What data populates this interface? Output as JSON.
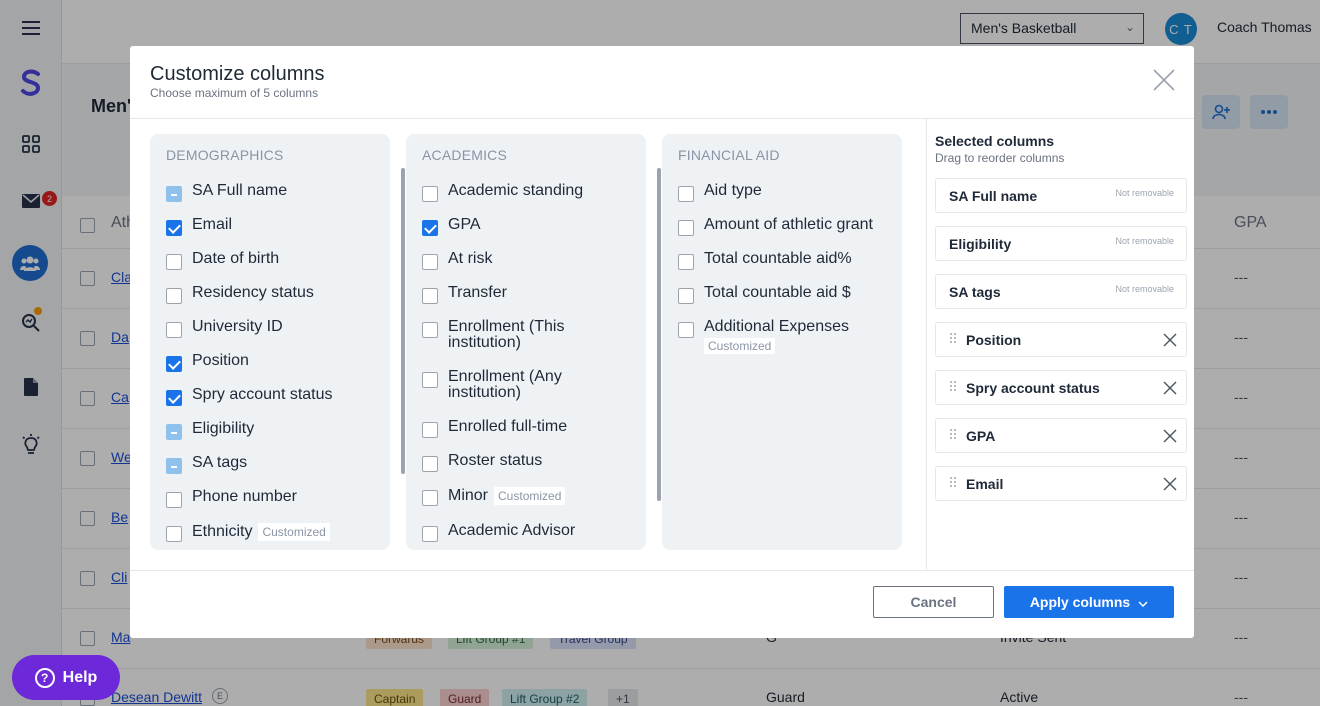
{
  "topbar": {
    "team": "Men's Basketball",
    "avatar_initials": "C T",
    "coach_name": "Coach Thomas"
  },
  "sidebar": {
    "mail_badge": "2"
  },
  "page": {
    "title": "Men'"
  },
  "table": {
    "header_partial": "Ath",
    "gpa_header": "GPA",
    "rows": [
      {
        "name": "Cla",
        "gpa": "---"
      },
      {
        "name": "Da",
        "gpa": "---"
      },
      {
        "name": "Ca",
        "gpa": "---"
      },
      {
        "name": "We",
        "gpa": "---"
      },
      {
        "name": "Be",
        "gpa": "---"
      },
      {
        "name": "Cli",
        "gpa": "---"
      },
      {
        "name": "Ma",
        "gpa": "---",
        "tags": [
          "Forwards",
          "Lift Group #1",
          "Travel Group"
        ],
        "position": "G",
        "status": "Invite Sent"
      },
      {
        "name": "Desean Dewitt",
        "gpa": "---",
        "tags": [
          "Captain",
          "Guard",
          "Lift Group #2",
          "+1"
        ],
        "position": "Guard",
        "status": "Active",
        "name_badge": "E"
      }
    ]
  },
  "help": {
    "label": "Help"
  },
  "modal": {
    "title": "Customize columns",
    "subtitle": "Choose maximum of 5 columns",
    "customized_label": "Customized",
    "demographics": {
      "heading": "DEMOGRAPHICS",
      "items": [
        {
          "label": "SA Full name",
          "state": "partial"
        },
        {
          "label": "Email",
          "state": "checked"
        },
        {
          "label": "Date of birth",
          "state": "unchecked"
        },
        {
          "label": "Residency status",
          "state": "unchecked"
        },
        {
          "label": "University ID",
          "state": "unchecked"
        },
        {
          "label": "Position",
          "state": "checked"
        },
        {
          "label": "Spry account status",
          "state": "checked"
        },
        {
          "label": "Eligibility",
          "state": "partial"
        },
        {
          "label": "SA tags",
          "state": "partial"
        },
        {
          "label": "Phone number",
          "state": "unchecked"
        },
        {
          "label": "Ethnicity",
          "state": "unchecked",
          "customized": true
        }
      ]
    },
    "academics": {
      "heading": "ACADEMICS",
      "items": [
        {
          "label": "Academic standing",
          "state": "unchecked"
        },
        {
          "label": "GPA",
          "state": "checked"
        },
        {
          "label": "At risk",
          "state": "unchecked"
        },
        {
          "label": "Transfer",
          "state": "unchecked"
        },
        {
          "label": "Enrollment (This institution)",
          "state": "unchecked"
        },
        {
          "label": "Enrollment (Any institution)",
          "state": "unchecked"
        },
        {
          "label": "Enrolled full-time",
          "state": "unchecked"
        },
        {
          "label": "Roster status",
          "state": "unchecked"
        },
        {
          "label": "Minor",
          "state": "unchecked",
          "customized": true
        },
        {
          "label": "Academic Advisor",
          "state": "unchecked"
        }
      ]
    },
    "financial_aid": {
      "heading": "FINANCIAL AID",
      "items": [
        {
          "label": "Aid type",
          "state": "unchecked"
        },
        {
          "label": "Amount of athletic grant",
          "state": "unchecked"
        },
        {
          "label": "Total countable aid%",
          "state": "unchecked"
        },
        {
          "label": "Total countable aid $",
          "state": "unchecked"
        },
        {
          "label": "Additional Expenses",
          "state": "unchecked",
          "customized": true
        }
      ]
    },
    "selected": {
      "title": "Selected columns",
      "subtitle": "Drag to reorder columns",
      "not_removable_label": "Not removable",
      "items": [
        {
          "label": "SA Full name",
          "removable": false
        },
        {
          "label": "Eligibility",
          "removable": false
        },
        {
          "label": "SA tags",
          "removable": false
        },
        {
          "label": "Position",
          "removable": true
        },
        {
          "label": "Spry account status",
          "removable": true
        },
        {
          "label": "GPA",
          "removable": true
        },
        {
          "label": "Email",
          "removable": true
        }
      ]
    },
    "cancel_label": "Cancel",
    "apply_label": "Apply columns"
  },
  "colors": {
    "primary": "#1a73e8",
    "partial": "#8ec2ec",
    "help": "#6d28d9",
    "panel_bg": "#eff2f5"
  }
}
